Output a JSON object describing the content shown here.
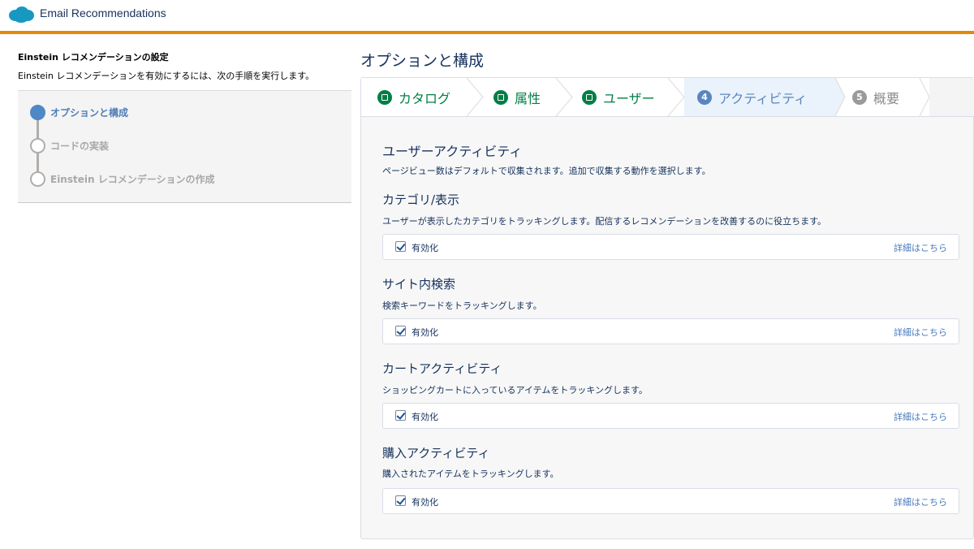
{
  "header": {
    "app_title": "Email Recommendations",
    "accent_color": "#e38a0b",
    "logo_icon": "salesforce-cloud-icon"
  },
  "left": {
    "title": "Einstein レコメンデーションの設定",
    "description": "Einstein レコメンデーションを有効にするには、次の手順を実行します。",
    "steps": [
      {
        "label": "オプションと構成",
        "state": "active"
      },
      {
        "label": "コードの実装",
        "state": "pending"
      },
      {
        "label": "Einstein レコメンデーションの作成",
        "state": "pending"
      }
    ]
  },
  "main": {
    "page_title": "オプションと構成",
    "tabs": [
      {
        "label": "カタログ",
        "badge": "",
        "state": "done"
      },
      {
        "label": "属性",
        "badge": "",
        "state": "done"
      },
      {
        "label": "ユーザー",
        "badge": "",
        "state": "done"
      },
      {
        "label": "アクティビティ",
        "badge": "4",
        "state": "current"
      },
      {
        "label": "概要",
        "badge": "5",
        "state": "todo"
      }
    ],
    "intro": {
      "heading": "ユーザーアクティビティ",
      "description": "ページビュー数はデフォルトで収集されます。追加で収集する動作を選択します。"
    },
    "sections": [
      {
        "heading": "カテゴリ/表示",
        "description": "ユーザーが表示したカテゴリをトラッキングします。配信するレコメンデーションを改善するのに役立ちます。",
        "checkbox_label": "有効化",
        "checked": true,
        "link": "詳細はこちら"
      },
      {
        "heading": "サイト内検索",
        "description": "検索キーワードをトラッキングします。",
        "checkbox_label": "有効化",
        "checked": true,
        "link": "詳細はこちら"
      },
      {
        "heading": "カートアクティビティ",
        "description": "ショッピングカートに入っているアイテムをトラッキングします。",
        "checkbox_label": "有効化",
        "checked": true,
        "link": "詳細はこちら"
      },
      {
        "heading": "購入アクティビティ",
        "description": "購入されたアイテムをトラッキングします。",
        "checkbox_label": "有効化",
        "checked": true,
        "link": "詳細はこちら"
      }
    ]
  }
}
